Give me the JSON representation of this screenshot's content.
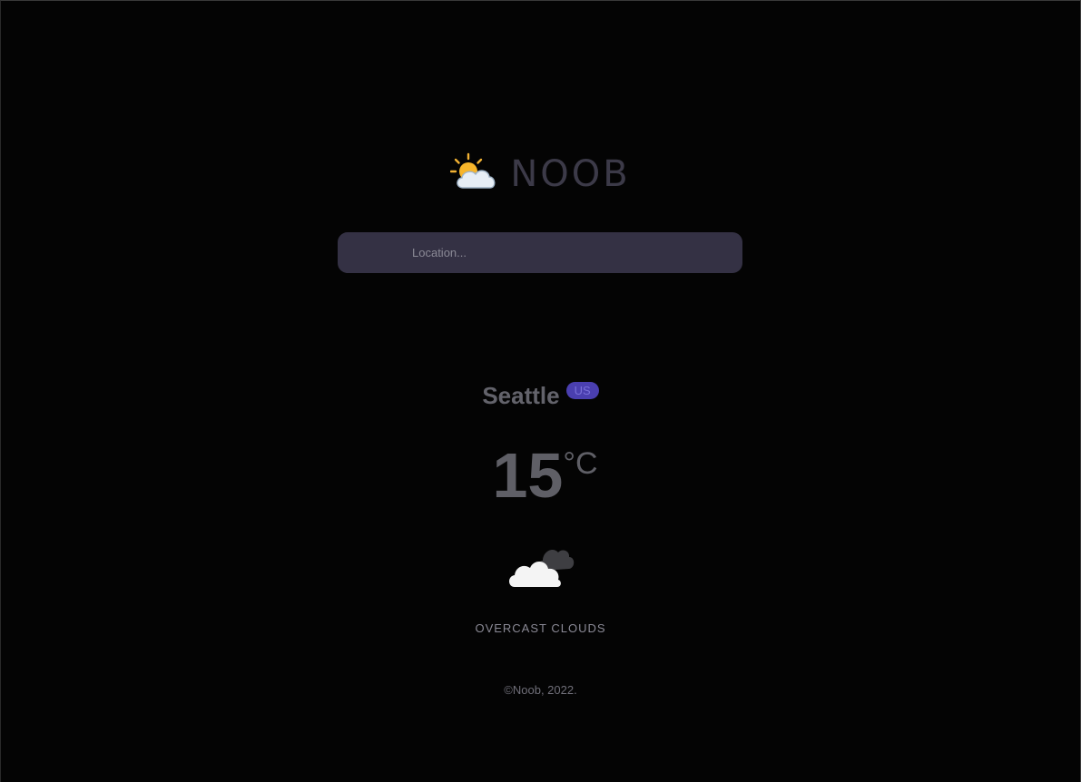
{
  "brand": {
    "name": "NOOB",
    "icon": "sun-behind-cloud-icon"
  },
  "search": {
    "placeholder": "Location...",
    "value": ""
  },
  "weather": {
    "city": "Seattle",
    "country": "US",
    "temperature": "15",
    "unit": "°C",
    "icon": "overcast-clouds-icon",
    "description": "OVERCAST CLOUDS"
  },
  "footer": {
    "text": "©Noob, 2022."
  },
  "colors": {
    "background": "#040404",
    "search_bg": "#343144",
    "badge_bg": "#4a3fb0"
  }
}
